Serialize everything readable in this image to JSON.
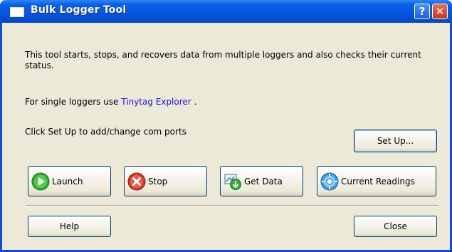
{
  "window": {
    "title": "Bulk Logger Tool"
  },
  "body": {
    "description": "This tool starts, stops, and recovers data from multiple loggers and also checks their current status.",
    "single_prefix": "For single loggers use",
    "single_link": "Tinytag Explorer",
    "single_suffix": ".",
    "setup_hint": "Click Set Up to add/change com ports"
  },
  "buttons": {
    "setup": "Set Up...",
    "launch": "Launch",
    "stop": "Stop",
    "get_data": "Get Data",
    "current_readings": "Current Readings",
    "help": "Help",
    "close": "Close"
  },
  "titlebar": {
    "help_glyph": "?",
    "close_glyph": "✕"
  },
  "icons": [
    "launch-icon",
    "stop-icon",
    "get-data-icon",
    "current-readings-icon"
  ],
  "colors": {
    "titlebar": "#0655df",
    "dialog": "#ece9d8",
    "link": "#1a14d8"
  }
}
